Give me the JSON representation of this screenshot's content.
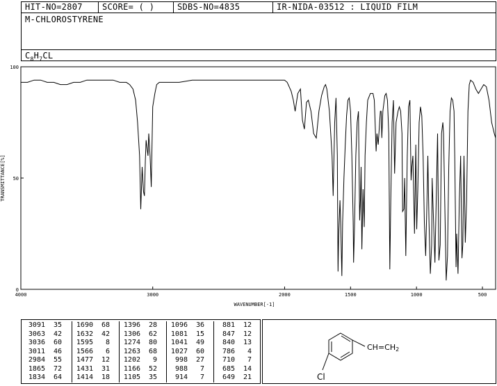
{
  "header": {
    "hit_no": "HIT-NO=2807",
    "score": "SCORE=  (   )",
    "sdbs_no": "SDBS-NO=4835",
    "ir_info": "IR-NIDA-03512 : LIQUID FILM",
    "compound_name": "M-CHLOROSTYRENE",
    "formula": {
      "prefix": "C",
      "c_count": "8",
      "mid": "H",
      "h_count": "7",
      "suffix": "CL"
    }
  },
  "chart_data": {
    "type": "line",
    "xlabel": "WAVENUMBER[-1]",
    "ylabel": "TRANSMITTANCE[%]",
    "xlim": [
      4000,
      400
    ],
    "ylim": [
      0,
      100
    ],
    "x_ticks": [
      4000,
      3000,
      2000,
      1500,
      1000,
      500
    ],
    "x_tick_labels": [
      "4000",
      "3000",
      "2000",
      "1500",
      "1000",
      "500"
    ],
    "y_ticks": [
      0,
      50,
      100
    ],
    "y_tick_labels": [
      "0",
      "50",
      "100"
    ],
    "series": [
      {
        "x": [
          4000,
          3950,
          3900,
          3850,
          3800,
          3750,
          3700,
          3650,
          3600,
          3550,
          3500,
          3450,
          3400,
          3350,
          3300,
          3250,
          3200,
          3175,
          3150,
          3130,
          3115,
          3100,
          3091,
          3080,
          3070,
          3063,
          3056,
          3050,
          3040,
          3036,
          3030,
          3020,
          3011,
          3000,
          2984,
          2970,
          2950,
          2900,
          2850,
          2800,
          2700,
          2600,
          2500,
          2400,
          2300,
          2200,
          2100,
          2050,
          2000,
          1980,
          1950,
          1934,
          1920,
          1900,
          1880,
          1865,
          1850,
          1834,
          1820,
          1800,
          1780,
          1760,
          1740,
          1720,
          1700,
          1690,
          1680,
          1660,
          1640,
          1632,
          1620,
          1610,
          1600,
          1595,
          1590,
          1580,
          1575,
          1566,
          1560,
          1550,
          1540,
          1530,
          1520,
          1510,
          1500,
          1490,
          1480,
          1477,
          1470,
          1460,
          1450,
          1440,
          1431,
          1425,
          1420,
          1414,
          1405,
          1396,
          1390,
          1380,
          1370,
          1350,
          1330,
          1320,
          1306,
          1300,
          1290,
          1274,
          1268,
          1263,
          1255,
          1240,
          1230,
          1220,
          1210,
          1202,
          1195,
          1185,
          1175,
          1166,
          1155,
          1140,
          1130,
          1120,
          1110,
          1105,
          1096,
          1090,
          1081,
          1070,
          1060,
          1050,
          1041,
          1035,
          1027,
          1015,
          1005,
          998,
          990,
          980,
          970,
          960,
          950,
          940,
          930,
          920,
          914,
          905,
          895,
          885,
          881,
          870,
          860,
          847,
          840,
          830,
          820,
          810,
          800,
          795,
          786,
          775,
          765,
          755,
          745,
          735,
          725,
          715,
          710,
          700,
          695,
          685,
          675,
          665,
          655,
          649,
          640,
          630,
          620,
          610,
          600,
          590,
          570,
          550,
          530,
          510,
          490,
          470,
          450,
          430,
          410,
          400
        ],
        "y": [
          93,
          93,
          94,
          94,
          93,
          93,
          92,
          92,
          93,
          93,
          94,
          94,
          94,
          94,
          94,
          93,
          93,
          92,
          90,
          85,
          75,
          60,
          36,
          55,
          44,
          42,
          58,
          67,
          62,
          60,
          70,
          60,
          46,
          82,
          88,
          92,
          93,
          93,
          93,
          93,
          94,
          94,
          94,
          94,
          94,
          94,
          94,
          94,
          94,
          93,
          89,
          85,
          80,
          88,
          90,
          76,
          72,
          84,
          85,
          80,
          70,
          68,
          80,
          87,
          91,
          92,
          90,
          80,
          60,
          42,
          75,
          86,
          60,
          8,
          24,
          40,
          30,
          6,
          30,
          50,
          65,
          78,
          85,
          86,
          80,
          60,
          30,
          12,
          28,
          60,
          75,
          80,
          31,
          40,
          55,
          18,
          45,
          28,
          60,
          75,
          85,
          88,
          88,
          85,
          62,
          70,
          65,
          80,
          80,
          68,
          80,
          87,
          88,
          85,
          70,
          9,
          40,
          75,
          85,
          52,
          75,
          80,
          82,
          80,
          70,
          35,
          36,
          50,
          15,
          60,
          82,
          85,
          49,
          55,
          60,
          25,
          65,
          27,
          45,
          75,
          82,
          78,
          60,
          30,
          15,
          40,
          60,
          30,
          7,
          20,
          50,
          30,
          12,
          50,
          70,
          13,
          20,
          70,
          75,
          70,
          40,
          4,
          15,
          55,
          80,
          86,
          85,
          80,
          60,
          10,
          25,
          7,
          40,
          60,
          14,
          20,
          60,
          21,
          40,
          80,
          92,
          94,
          93,
          90,
          88,
          90,
          92,
          91,
          85,
          75,
          70,
          68
        ]
      }
    ]
  },
  "peak_table": {
    "columns": [
      [
        [
          "3091",
          "35"
        ],
        [
          "3063",
          "42"
        ],
        [
          "3036",
          "60"
        ],
        [
          "3011",
          "46"
        ],
        [
          "2984",
          "55"
        ],
        [
          "1865",
          "72"
        ],
        [
          "1834",
          "64"
        ]
      ],
      [
        [
          "1690",
          "68"
        ],
        [
          "1632",
          "42"
        ],
        [
          "1595",
          "8"
        ],
        [
          "1566",
          "6"
        ],
        [
          "1477",
          "12"
        ],
        [
          "1431",
          "31"
        ],
        [
          "1414",
          "18"
        ]
      ],
      [
        [
          "1396",
          "28"
        ],
        [
          "1306",
          "62"
        ],
        [
          "1274",
          "80"
        ],
        [
          "1263",
          "68"
        ],
        [
          "1202",
          "9"
        ],
        [
          "1166",
          "52"
        ],
        [
          "1105",
          "35"
        ]
      ],
      [
        [
          "1096",
          "36"
        ],
        [
          "1081",
          "15"
        ],
        [
          "1041",
          "49"
        ],
        [
          "1027",
          "60"
        ],
        [
          "998",
          "27"
        ],
        [
          "988",
          "7"
        ],
        [
          "914",
          "7"
        ]
      ],
      [
        [
          "881",
          "12"
        ],
        [
          "847",
          "12"
        ],
        [
          "840",
          "13"
        ],
        [
          "786",
          "4"
        ],
        [
          "710",
          "7"
        ],
        [
          "685",
          "14"
        ],
        [
          "649",
          "21"
        ]
      ]
    ]
  },
  "structure": {
    "vinyl_label": "CH=CH",
    "vinyl_sub": "2",
    "substituent_label": "Cl"
  }
}
